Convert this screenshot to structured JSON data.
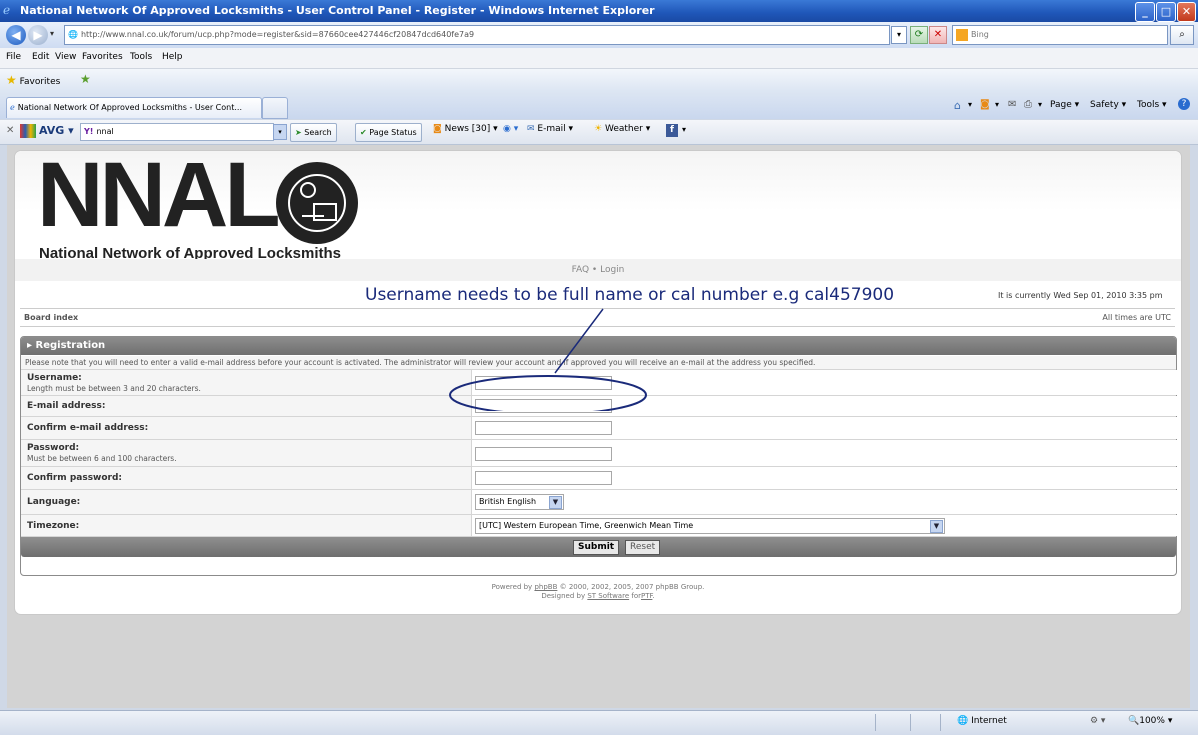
{
  "window": {
    "title": "National Network Of Approved Locksmiths - User Control Panel - Register - Windows Internet Explorer",
    "min_glyph": "_",
    "max_glyph": "□",
    "close_glyph": "✕"
  },
  "address": {
    "url": "http://www.nnal.co.uk/forum/ucp.php?mode=register&sid=87660cee427446cf20847dcd640fe7a9",
    "search_placeholder": "Bing"
  },
  "menu": [
    "File",
    "Edit",
    "View",
    "Favorites",
    "Tools",
    "Help"
  ],
  "favorites": {
    "label": "Favorites"
  },
  "tabs": [
    {
      "label": "National Network Of Approved Locksmiths - User Cont..."
    }
  ],
  "command_bar": {
    "page": "Page ▾",
    "safety": "Safety ▾",
    "tools": "Tools ▾"
  },
  "avg_toolbar": {
    "brand": "AVG ▾",
    "search_value": "nnal",
    "search_btn": "Search",
    "page_status": "Page Status",
    "news": "News [30] ▾",
    "email": "E-mail ▾",
    "weather": "Weather ▾"
  },
  "site": {
    "logo_text": "NNAL",
    "logo_subtitle": "National Network of Approved Locksmiths",
    "nav_faq": "FAQ",
    "nav_sep": "•",
    "nav_login": "Login",
    "annotation": "Username needs to be full name or cal number e.g cal457900",
    "datetime": "It is currently Wed Sep 01, 2010 3:35 pm",
    "board_index": "Board index",
    "timezone_note": "All times are UTC"
  },
  "form": {
    "heading": "▸ Registration",
    "notice": "Please note that you will need to enter a valid e-mail address before your account is activated. The administrator will review your account and if approved you will receive an e-mail at the address you specified.",
    "fields": {
      "username": {
        "label": "Username:",
        "hint": "Length must be between 3 and 20 characters.",
        "value": ""
      },
      "email": {
        "label": "E-mail address:",
        "value": ""
      },
      "email_confirm": {
        "label": "Confirm e-mail address:",
        "value": ""
      },
      "password": {
        "label": "Password:",
        "hint": "Must be between 6 and 100 characters.",
        "value": ""
      },
      "password_confirm": {
        "label": "Confirm password:",
        "value": ""
      },
      "language": {
        "label": "Language:",
        "value": "British English"
      },
      "timezone": {
        "label": "Timezone:",
        "value": "[UTC] Western European Time, Greenwich Mean Time"
      }
    },
    "submit": "Submit",
    "reset": "Reset"
  },
  "footer": {
    "powered_prefix": "Powered by",
    "phpbb_link": "phpBB",
    "powered_suffix": "© 2000, 2002, 2005, 2007 phpBB Group.",
    "designed_prefix": "Designed by",
    "designer_link": "ST Software",
    "designed_mid": "for",
    "ptf_link": "PTF",
    "designed_end": "."
  },
  "status": {
    "zone": "Internet",
    "zoom": "100%"
  },
  "colors": {
    "titlebar": "#1f56b8",
    "form_header": "#7a7a7a",
    "annotation": "#1a2a7a"
  }
}
